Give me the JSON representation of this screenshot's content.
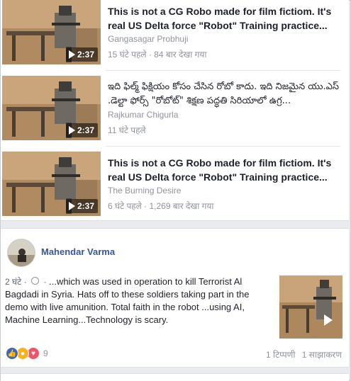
{
  "videos": [
    {
      "title": "This is not a CG Robo made for film fictiom. It's real US Delta force \"Robot\" Training practice...",
      "author": "Gangasagar Probhuji",
      "meta": "15 घंटे पहले · 84 बार देखा गया",
      "duration": "2:37"
    },
    {
      "title": "ఇది ఫిల్మ్ ఫిక్షియం కోసం చేసిన రోబో కాదు. ఇది నిజమైన యు.ఎస్ .డెల్టా ఫోర్స్ \"రోబోట్\" శిక్షణ పద్ధతి సిరియాలో ఉగ్ర...",
      "author": "Rajkumar Chigurla",
      "meta": "11 घंटे पहले",
      "duration": "2:37"
    },
    {
      "title": "This is not a CG Robo made for film fictiom. It's real US Delta force \"Robot\" Training practice...",
      "author": "The Burning Desire",
      "meta": "6 घंटे पहले · 1,269 बार देखा गया",
      "duration": "2:37"
    }
  ],
  "post": {
    "author": "Mahendar Varma",
    "time": "2 घंटे",
    "text": "...which was used in operation to kill Terrorist Al Bagdadi in Syria. Hats off to these soldiers taking part in the demo with live amunition. Total faith in the robot ...using AI, Machine Learning...Technology is scary.",
    "reaction_count": "9",
    "comments": "1 टिप्पणी",
    "shares": "1 साझाकरण"
  },
  "colors": {
    "link_blue": "#365899",
    "muted": "#90949c",
    "like": "#4267b2",
    "wow": "#f7b125",
    "love": "#f25268"
  }
}
